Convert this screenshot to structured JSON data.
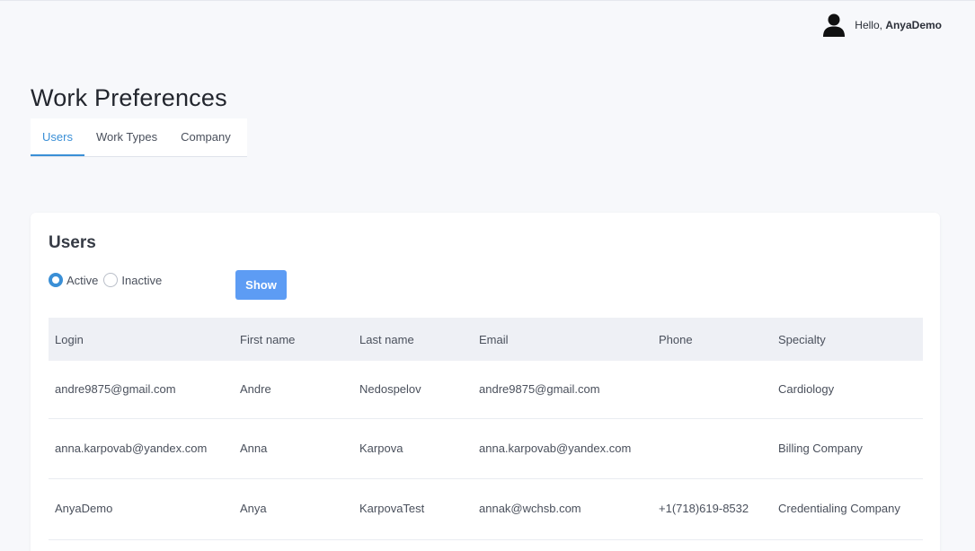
{
  "header": {
    "greeting_prefix": "Hello,",
    "username": "AnyaDemo"
  },
  "page": {
    "title": "Work Preferences"
  },
  "tabs": [
    {
      "label": "Users",
      "active": true
    },
    {
      "label": "Work Types",
      "active": false
    },
    {
      "label": "Company",
      "active": false
    }
  ],
  "users_card": {
    "title": "Users",
    "filter": {
      "options": [
        "Active",
        "Inactive"
      ],
      "selected": "Active"
    },
    "show_label": "Show",
    "columns": [
      "Login",
      "First name",
      "Last name",
      "Email",
      "Phone",
      "Specialty"
    ],
    "rows": [
      {
        "login": "andre9875@gmail.com",
        "first": "Andre",
        "last": "Nedospelov",
        "email": "andre9875@gmail.com",
        "phone": "",
        "specialty": "Cardiology"
      },
      {
        "login": "anna.karpovab@yandex.com",
        "first": "Anna",
        "last": "Karpova",
        "email": "anna.karpovab@yandex.com",
        "phone": "",
        "specialty": "Billing Company"
      },
      {
        "login": "AnyaDemo",
        "first": "Anya",
        "last": "KarpovaTest",
        "email": "annak@wchsb.com",
        "phone": "+1(718)619-8532",
        "specialty": "Credentialing Company"
      }
    ]
  },
  "colors": {
    "accent": "#3a8fd6",
    "button": "#5d9cf4",
    "background": "#f7f8fb",
    "table_header": "#eef0f5"
  },
  "icons": {
    "avatar": "user-silhouette-icon"
  }
}
